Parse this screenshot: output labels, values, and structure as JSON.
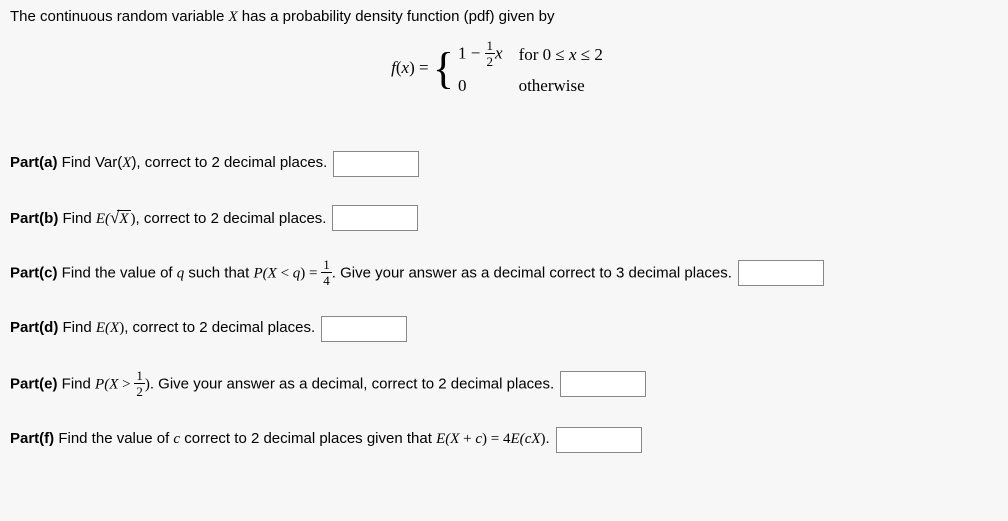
{
  "intro": {
    "prefix": "The continuous random variable ",
    "var": "X",
    "suffix": " has a probability density function (pdf) given by"
  },
  "pdf": {
    "lhs_f": "f",
    "lhs_open": "(",
    "lhs_var": "x",
    "lhs_close": ") = ",
    "piece1_lead": "1 − ",
    "piece1_frac_num": "1",
    "piece1_frac_den": "2",
    "piece1_var": "x",
    "piece1_cond_for": "for ",
    "piece1_cond_lo": "0 ≤ ",
    "piece1_cond_var": "x",
    "piece1_cond_hi": " ≤ 2",
    "piece2_val": "0",
    "piece2_cond": "otherwise"
  },
  "parts": {
    "a": {
      "label": "Part(a)",
      "t1": " Find Var(",
      "var": "X",
      "t2": "), correct to 2 decimal places."
    },
    "b": {
      "label": "Part(b)",
      "t1": " Find ",
      "e_open": "E(",
      "sqrt_var": "X",
      "e_close": ")",
      "t2": ", correct to 2 decimal places."
    },
    "c": {
      "label": "Part(c)",
      "t1": " Find the value of ",
      "qvar": "q",
      "t2": " such that ",
      "p_open": "P(",
      "big_x": "X",
      "lt": " < ",
      "qvar2": "q",
      "p_close": ") = ",
      "frac_num": "1",
      "frac_den": "4",
      "t3": ". Give your answer as a decimal correct to 3 decimal places."
    },
    "d": {
      "label": "Part(d)",
      "t1": " Find ",
      "ex": "E(X)",
      "e_open": "E(",
      "big_x": "X",
      "e_close": ")",
      "t2": ", correct to 2 decimal places."
    },
    "e": {
      "label": "Part(e)",
      "t1": " Find ",
      "p_open": "P(",
      "big_x": "X",
      "gt": " > ",
      "frac_num": "1",
      "frac_den": "2",
      "p_close": ")",
      "t2": ". Give your answer as a decimal, correct to 2 decimal places."
    },
    "f": {
      "label": "Part(f)",
      "t1": " Find the value of ",
      "cvar": "c",
      "t2": " correct to 2 decimal places given that ",
      "eq_l_open": "E(",
      "eq_l_x": "X",
      "eq_l_plus": " + ",
      "eq_l_c": "c",
      "eq_l_close": ") = 4",
      "eq_r_open": "E(",
      "eq_r_c": "c",
      "eq_r_x": "X",
      "eq_r_close": ")",
      "t3": "."
    }
  }
}
